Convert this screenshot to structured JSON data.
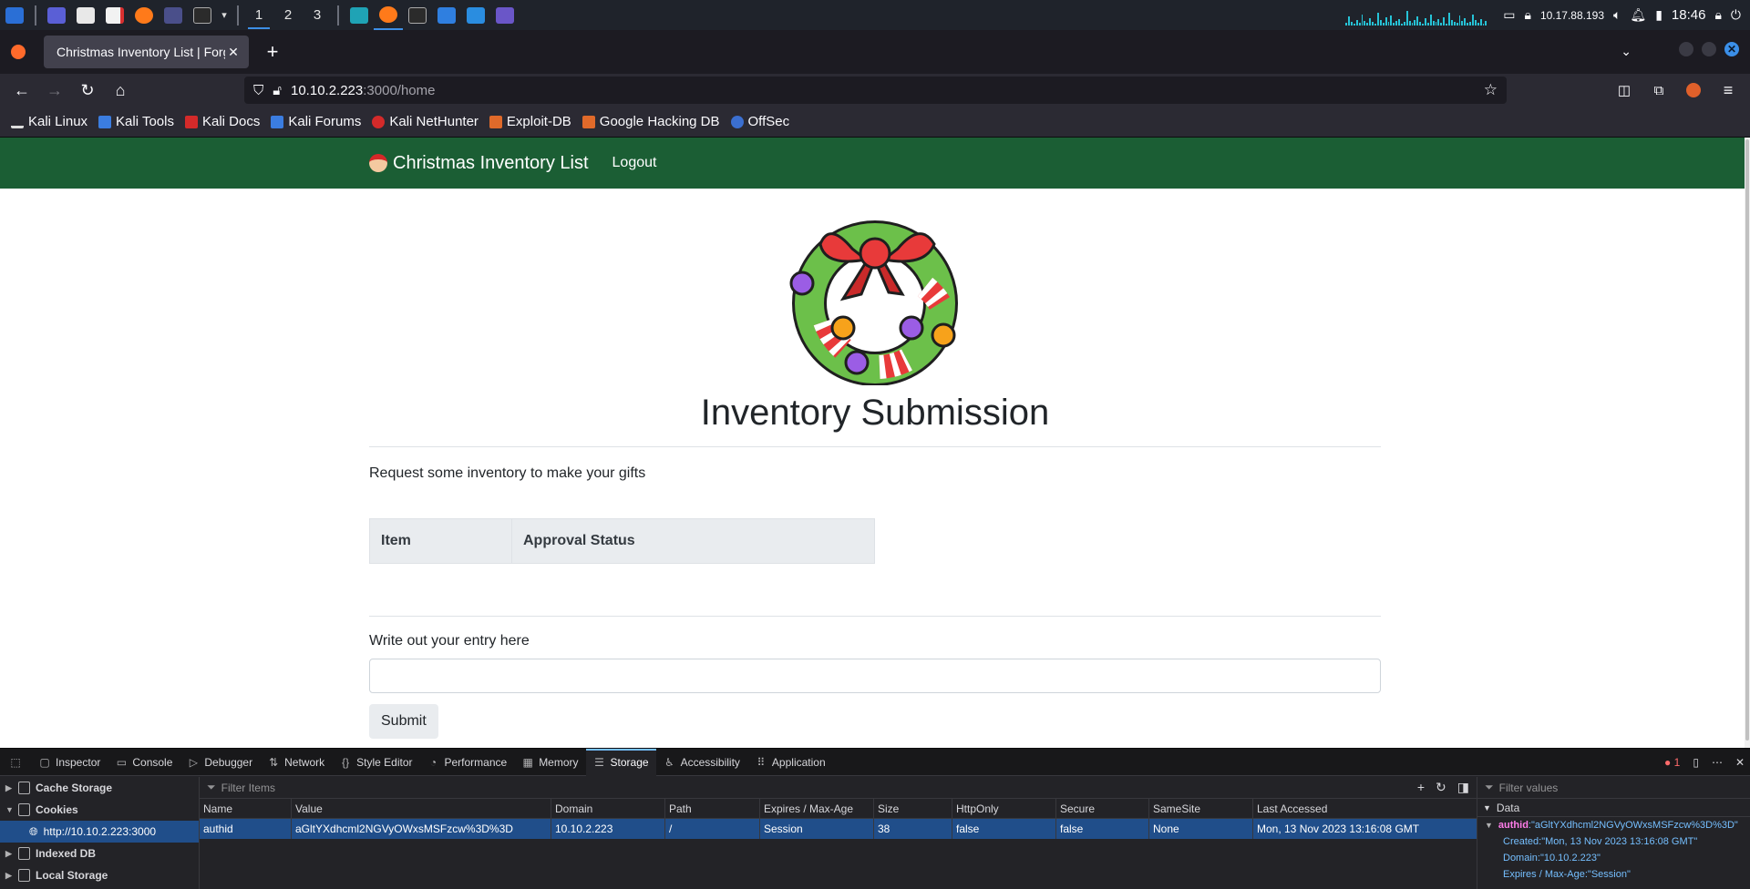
{
  "taskbar": {
    "workspaces": [
      "1",
      "2",
      "3"
    ],
    "ip": "10.17.88.193",
    "clock": "18:46"
  },
  "browser": {
    "tab_title": "Christmas Inventory List | Forge",
    "url_host": "10.10.2.223",
    "url_path": ":3000/home",
    "bookmarks": [
      "Kali Linux",
      "Kali Tools",
      "Kali Docs",
      "Kali Forums",
      "Kali NetHunter",
      "Exploit-DB",
      "Google Hacking DB",
      "OffSec"
    ]
  },
  "site": {
    "brand": "Christmas Inventory List",
    "logout": "Logout",
    "heading": "Inventory Submission",
    "lead": "Request some inventory to make your gifts",
    "table_headers": [
      "Item",
      "Approval Status"
    ],
    "entry_label": "Write out your entry here",
    "entry_value": "",
    "submit": "Submit"
  },
  "devtools": {
    "tabs": [
      "Inspector",
      "Console",
      "Debugger",
      "Network",
      "Style Editor",
      "Performance",
      "Memory",
      "Storage",
      "Accessibility",
      "Application"
    ],
    "error_count": "1",
    "tree": {
      "cache": "Cache Storage",
      "cookies": "Cookies",
      "cookie_origin": "http://10.10.2.223:3000",
      "indexeddb": "Indexed DB",
      "localstorage": "Local Storage"
    },
    "filter_items_placeholder": "Filter Items",
    "filter_values_placeholder": "Filter values",
    "columns": [
      "Name",
      "Value",
      "Domain",
      "Path",
      "Expires / Max-Age",
      "Size",
      "HttpOnly",
      "Secure",
      "SameSite",
      "Last Accessed"
    ],
    "cookie_row": [
      "authid",
      "aGltYXdhcml2NGVyOWxsMSFzcw%3D%3D",
      "10.10.2.223",
      "/",
      "Session",
      "38",
      "false",
      "false",
      "None",
      "Mon, 13 Nov 2023 13:16:08 GMT"
    ],
    "data_panel": {
      "title": "Data",
      "main_key": "authid",
      "main_value": ":\"aGltYXdhcml2NGVyOWxsMSFzcw%3D%3D\"",
      "created": "Created:\"Mon, 13 Nov 2023 13:16:08 GMT\"",
      "domain": "Domain:\"10.10.2.223\"",
      "expires": "Expires / Max-Age:\"Session\""
    }
  }
}
